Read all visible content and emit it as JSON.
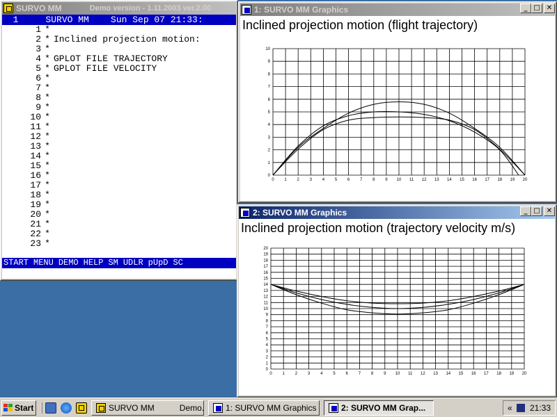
{
  "editor": {
    "title": "SURVO MM",
    "title_extra": "Demo version  - 1.11.2003 ver.2.00",
    "header": "  1     SURVO MM    Sun Sep 07 21:33:",
    "lines": [
      {
        "num": "1",
        "ctrl": "*",
        "text": ""
      },
      {
        "num": "2",
        "ctrl": "*",
        "text": "Inclined projection motion:"
      },
      {
        "num": "3",
        "ctrl": "*",
        "text": ""
      },
      {
        "num": "4",
        "ctrl": "*",
        "text": "GPLOT FILE TRAJECTORY"
      },
      {
        "num": "5",
        "ctrl": "*",
        "text": "GPLOT FILE VELOCITY"
      },
      {
        "num": "6",
        "ctrl": "*",
        "text": ""
      },
      {
        "num": "7",
        "ctrl": "*",
        "text": ""
      },
      {
        "num": "8",
        "ctrl": "*",
        "text": ""
      },
      {
        "num": "9",
        "ctrl": "*",
        "text": ""
      },
      {
        "num": "10",
        "ctrl": "*",
        "text": ""
      },
      {
        "num": "11",
        "ctrl": "*",
        "text": ""
      },
      {
        "num": "12",
        "ctrl": "*",
        "text": ""
      },
      {
        "num": "13",
        "ctrl": "*",
        "text": ""
      },
      {
        "num": "14",
        "ctrl": "*",
        "text": ""
      },
      {
        "num": "15",
        "ctrl": "*",
        "text": ""
      },
      {
        "num": "16",
        "ctrl": "*",
        "text": ""
      },
      {
        "num": "17",
        "ctrl": "*",
        "text": ""
      },
      {
        "num": "18",
        "ctrl": "*",
        "text": ""
      },
      {
        "num": "19",
        "ctrl": "*",
        "text": ""
      },
      {
        "num": "20",
        "ctrl": "*",
        "text": ""
      },
      {
        "num": "21",
        "ctrl": "*",
        "text": ""
      },
      {
        "num": "22",
        "ctrl": "*",
        "text": ""
      },
      {
        "num": "23",
        "ctrl": "*",
        "text": ""
      }
    ],
    "footer": [
      "START",
      "MENU",
      "DEMO",
      "HELP",
      "SM",
      "UDLR",
      "pUpD",
      "SC"
    ]
  },
  "graphics1": {
    "window_title": "1: SURVO MM  Graphics",
    "title": "Inclined projection motion (flight trajectory)"
  },
  "graphics2": {
    "window_title": "2: SURVO MM  Graphics",
    "title": "Inclined projection motion (trajectory velocity m/s)"
  },
  "chart_data": [
    {
      "type": "line",
      "title": "Inclined projection motion (flight trajectory)",
      "xlim": [
        0,
        20
      ],
      "ylim": [
        0,
        10
      ],
      "xticks": [
        0,
        1,
        2,
        3,
        4,
        5,
        6,
        7,
        8,
        9,
        10,
        11,
        12,
        13,
        14,
        15,
        16,
        17,
        18,
        19,
        20
      ],
      "yticks": [
        0,
        1,
        2,
        3,
        4,
        5,
        6,
        7,
        8,
        9,
        10
      ],
      "grid": true,
      "series": [
        {
          "x": [
            0,
            2,
            4,
            6,
            8,
            10,
            12,
            14,
            16,
            18,
            20
          ],
          "y": [
            0,
            2.05,
            3.6,
            4.35,
            4.55,
            4.6,
            4.55,
            4.35,
            3.6,
            2.05,
            0
          ],
          "range_end": 20
        },
        {
          "x": [
            0,
            2,
            4,
            6,
            8,
            10,
            12,
            14,
            16,
            18,
            19.5
          ],
          "y": [
            0,
            2.3,
            3.9,
            4.7,
            5.0,
            5.0,
            4.8,
            4.3,
            3.4,
            2.0,
            0
          ],
          "range_end": 19.5
        },
        {
          "x": [
            0,
            2,
            4,
            6,
            8,
            10,
            12,
            14,
            16,
            18,
            20
          ],
          "y": [
            0,
            2.2,
            3.7,
            4.9,
            5.6,
            5.8,
            5.6,
            4.9,
            3.7,
            2.2,
            0
          ],
          "range_end": 20
        }
      ]
    },
    {
      "type": "line",
      "title": "Inclined projection motion (trajectory velocity m/s)",
      "xlim": [
        0,
        20
      ],
      "ylim": [
        0,
        20
      ],
      "xticks": [
        0,
        1,
        2,
        3,
        4,
        5,
        6,
        7,
        8,
        9,
        10,
        11,
        12,
        13,
        14,
        15,
        16,
        17,
        18,
        19,
        20
      ],
      "yticks": [
        0,
        1,
        2,
        3,
        4,
        5,
        6,
        7,
        8,
        9,
        10,
        11,
        12,
        13,
        14,
        15,
        16,
        17,
        18,
        19,
        20
      ],
      "grid": true,
      "series": [
        {
          "x": [
            0,
            2,
            4,
            6,
            8,
            10,
            12,
            14,
            16,
            18,
            20
          ],
          "y": [
            14,
            12.9,
            12.0,
            11.3,
            10.9,
            10.8,
            10.9,
            11.3,
            12.0,
            12.9,
            14
          ]
        },
        {
          "x": [
            0,
            2,
            4,
            6,
            8,
            10,
            12,
            14,
            16,
            18,
            20
          ],
          "y": [
            14,
            12.6,
            11.5,
            10.7,
            10.2,
            10.0,
            10.2,
            10.7,
            11.5,
            12.6,
            14
          ]
        },
        {
          "x": [
            0,
            2,
            4,
            6,
            8,
            10,
            12,
            14,
            16,
            18,
            20
          ],
          "y": [
            14,
            12.3,
            10.9,
            9.8,
            9.3,
            9.1,
            9.3,
            9.8,
            10.9,
            12.3,
            14
          ]
        }
      ]
    }
  ],
  "taskbar": {
    "start_label": "Start",
    "tasks": [
      {
        "label": "SURVO MM",
        "extra": "Demo...",
        "pressed": false
      },
      {
        "label": "1: SURVO MM  Graphics",
        "extra": "",
        "pressed": false
      },
      {
        "label": "2: SURVO MM  Grap...",
        "extra": "",
        "pressed": true
      }
    ],
    "tray_arrows": "«",
    "clock": "21:33"
  },
  "window_buttons": {
    "minimize": "_",
    "maximize": "□",
    "close": "✕"
  },
  "colors": {
    "desktop": "#3a6ea5",
    "survo_blue": "#0000c0",
    "title_active": "#0a246a"
  }
}
